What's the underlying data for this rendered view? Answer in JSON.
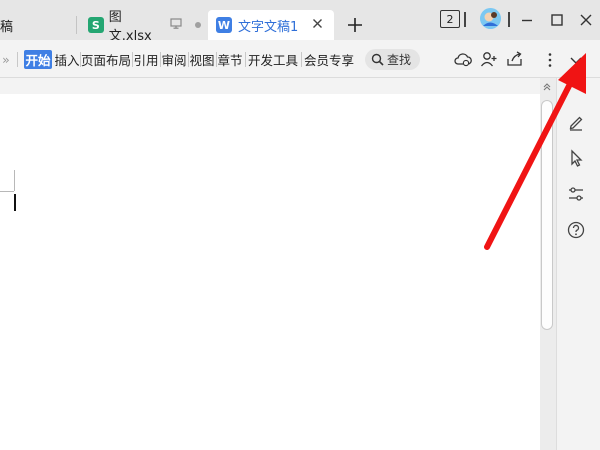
{
  "tabs": [
    {
      "label": "稿",
      "active": false
    },
    {
      "label": "图文.xlsx",
      "icon": "spreadsheet-s-icon",
      "icon_letter": "S",
      "active": false
    },
    {
      "label": "文字文稿1",
      "icon": "writer-w-icon",
      "icon_letter": "W",
      "active": true
    }
  ],
  "window": {
    "tab_count": "2"
  },
  "toolbar": {
    "overflow_symbol": "»",
    "menus": [
      "开始",
      "插入",
      "页面布局",
      "引用",
      "审阅",
      "视图",
      "章节",
      "开发工具",
      "会员专享"
    ],
    "active_menu": "开始",
    "search_label": "查找"
  },
  "side_panel": {
    "tools": [
      "pencil-icon",
      "pointer-icon",
      "sliders-icon",
      "help-icon"
    ]
  },
  "colors": {
    "accent": "#3f7fe4",
    "spreadsheet": "#24a672",
    "annotation_arrow": "#f01414"
  }
}
